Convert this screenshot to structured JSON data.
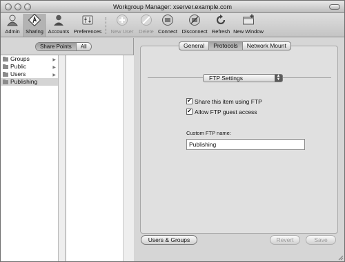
{
  "window": {
    "title": "Workgroup Manager: xserver.example.com"
  },
  "toolbar": {
    "items": [
      {
        "label": "Admin",
        "icon": "admin-icon",
        "enabled": true,
        "selected": false
      },
      {
        "label": "Sharing",
        "icon": "sharing-icon",
        "enabled": true,
        "selected": true
      },
      {
        "label": "Accounts",
        "icon": "accounts-icon",
        "enabled": true,
        "selected": false
      },
      {
        "label": "Preferences",
        "icon": "preferences-icon",
        "enabled": true,
        "selected": false
      },
      {
        "label": "New User",
        "icon": "new-user-icon",
        "enabled": false,
        "selected": false
      },
      {
        "label": "Delete",
        "icon": "delete-icon",
        "enabled": false,
        "selected": false
      },
      {
        "label": "Connect",
        "icon": "connect-icon",
        "enabled": true,
        "selected": false
      },
      {
        "label": "Disconnect",
        "icon": "disconnect-icon",
        "enabled": true,
        "selected": false
      },
      {
        "label": "Refresh",
        "icon": "refresh-icon",
        "enabled": true,
        "selected": false
      },
      {
        "label": "New Window",
        "icon": "new-window-icon",
        "enabled": true,
        "selected": false
      }
    ]
  },
  "left": {
    "segments": [
      "Share Points",
      "All"
    ],
    "selected_segment": "Share Points",
    "items": [
      {
        "label": "Groups",
        "has_children": true
      },
      {
        "label": "Public",
        "has_children": true
      },
      {
        "label": "Users",
        "has_children": true
      },
      {
        "label": "Publishing",
        "has_children": false,
        "selected": true
      }
    ]
  },
  "right": {
    "tabs": [
      "General",
      "Protocols",
      "Network Mount"
    ],
    "selected_tab": "Protocols",
    "protocol_popup": "FTP Settings",
    "checkboxes": [
      {
        "label": "Share this item using FTP",
        "checked": true
      },
      {
        "label": "Allow FTP guest access",
        "checked": true
      }
    ],
    "custom_name_label": "Custom FTP name:",
    "custom_name_value": "Publishing",
    "users_groups_button": "Users & Groups",
    "revert_button": "Revert",
    "save_button": "Save"
  }
}
